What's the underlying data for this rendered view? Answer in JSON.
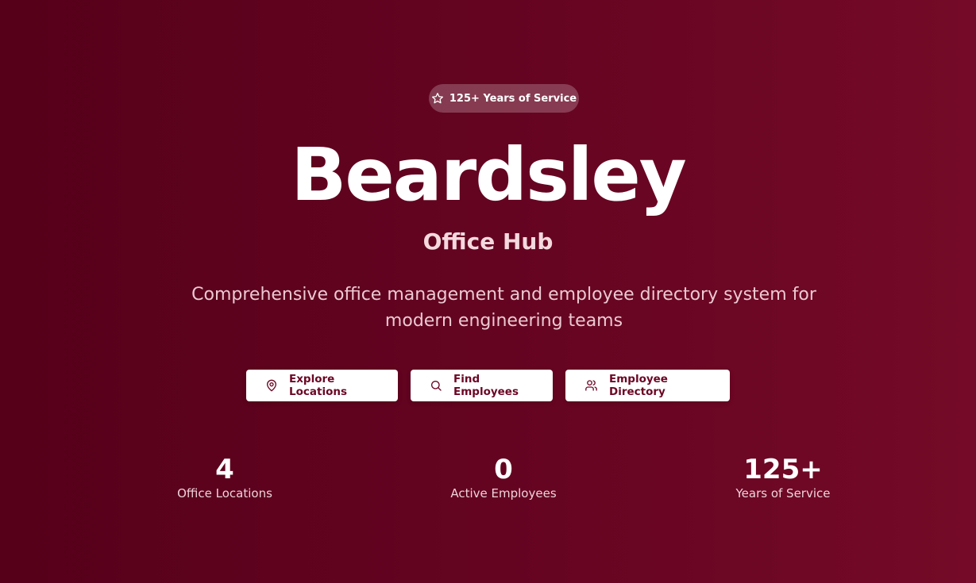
{
  "badge": {
    "icon": "star-icon",
    "label": "125+ Years of Service"
  },
  "hero": {
    "title": "Beardsley",
    "subtitle": "Office Hub",
    "description": "Comprehensive office management and employee directory system for modern engineering teams"
  },
  "actions": {
    "explore": {
      "icon": "map-pin-icon",
      "label": "Explore Locations"
    },
    "find": {
      "icon": "search-icon",
      "label": "Find Employees"
    },
    "directory": {
      "icon": "users-icon",
      "label": "Employee Directory"
    }
  },
  "stats": [
    {
      "value": "4",
      "label": "Office Locations"
    },
    {
      "value": "0",
      "label": "Active Employees"
    },
    {
      "value": "125+",
      "label": "Years of Service"
    }
  ],
  "colors": {
    "background_start": "#56001a",
    "background_end": "#740a27",
    "button_text": "#6b0624",
    "button_background": "#ffffff"
  }
}
